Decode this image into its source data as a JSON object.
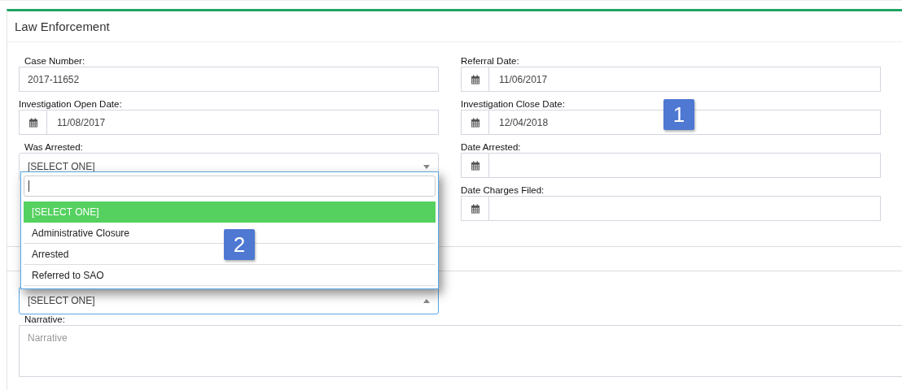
{
  "panel": {
    "title": "Law Enforcement"
  },
  "left_fields": [
    {
      "label": "Case Number:",
      "kind": "text",
      "value": "2017-11652"
    },
    {
      "label": "Investigation Open Date:",
      "kind": "date",
      "value": "11/08/2017"
    },
    {
      "label": "Was Arrested:",
      "kind": "select",
      "value": "[SELECT ONE]",
      "expanded": false
    }
  ],
  "right_fields": [
    {
      "label": "Referral Date:",
      "kind": "date",
      "value": "11/06/2017"
    },
    {
      "label": "Investigation Close Date:",
      "kind": "date",
      "value": "12/04/2018"
    },
    {
      "label": "Date Arrested:",
      "kind": "date"
    },
    {
      "label": "Date Charges Filed:",
      "kind": "date"
    }
  ],
  "lower_select": {
    "value": "[SELECT ONE]",
    "expanded": true
  },
  "dropdown": {
    "options": [
      {
        "label": "[SELECT ONE]",
        "selected": true
      },
      {
        "label": "Administrative Closure",
        "selected": false
      },
      {
        "label": "Arrested",
        "selected": false
      },
      {
        "label": "Referred to SAO",
        "selected": false
      }
    ]
  },
  "narrative": {
    "label": "Narrative:",
    "placeholder": "Narrative"
  },
  "markers": [
    {
      "text": "1"
    },
    {
      "text": "2"
    }
  ]
}
